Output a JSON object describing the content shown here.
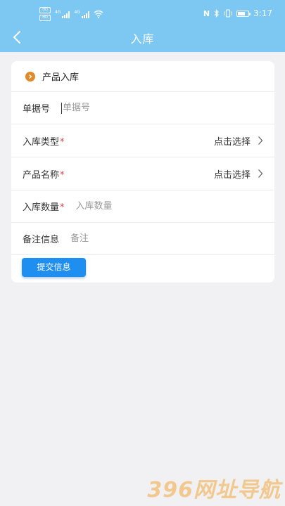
{
  "status_bar": {
    "sim1": "HD",
    "sim2": "HD",
    "signal1_label": "4G",
    "signal2_label": "4G",
    "nfc_icon": "N",
    "time": "3:17"
  },
  "nav": {
    "title": "入库"
  },
  "form": {
    "section_title": "产品入库",
    "fields": [
      {
        "label": "单据号",
        "required": false,
        "placeholder": "单据号"
      },
      {
        "label": "入库类型",
        "required": true,
        "action": "点击选择"
      },
      {
        "label": "产品名称",
        "required": true,
        "action": "点击选择"
      },
      {
        "label": "入库数量",
        "required": true,
        "placeholder": "入库数量"
      },
      {
        "label": "备注信息",
        "required": false,
        "placeholder": "备注"
      }
    ],
    "required_mark": "*",
    "submit_label": "提交信息"
  },
  "watermark": "396网址导航",
  "colors": {
    "header_bg": "#7cc8f3",
    "accent": "#1f8ef1",
    "required": "#e5454b",
    "section_icon": "#e08a2a"
  }
}
